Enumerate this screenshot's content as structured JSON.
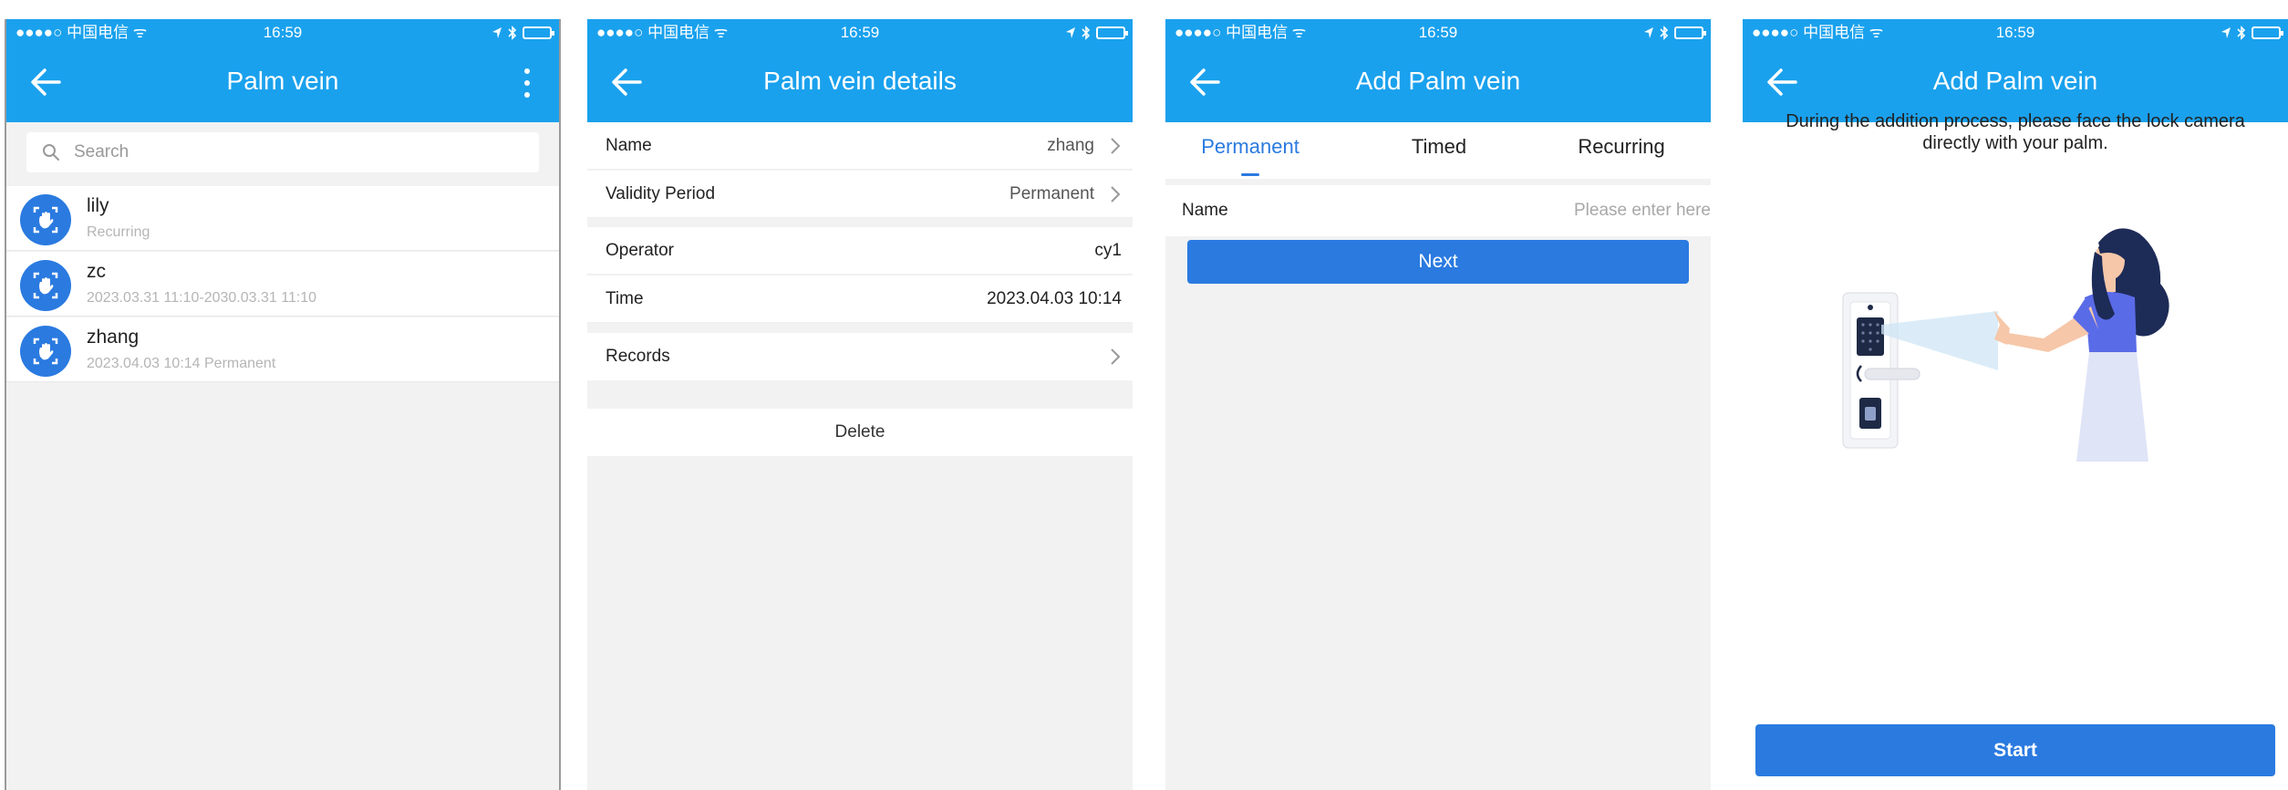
{
  "status_bar": {
    "carrier": "●●●●○ 中国电信 ᯤ",
    "time": "16:59"
  },
  "screen1": {
    "title": "Palm vein",
    "search_placeholder": "Search",
    "items": [
      {
        "name": "lily",
        "subtitle": "Recurring"
      },
      {
        "name": "zc",
        "subtitle": "2023.03.31 11:10-2030.03.31 11:10"
      },
      {
        "name": "zhang",
        "subtitle": "2023.04.03 10:14   Permanent"
      }
    ]
  },
  "screen2": {
    "title": "Palm vein details",
    "rows": [
      {
        "label": "Name",
        "value": "zhang"
      },
      {
        "label": "Validity Period",
        "value": "Permanent"
      },
      {
        "label": "Operator",
        "value": "cy1"
      },
      {
        "label": "Time",
        "value": "2023.04.03 10:14"
      },
      {
        "label": "Records",
        "value": ""
      }
    ],
    "delete_label": "Delete"
  },
  "screen3": {
    "title": "Add Palm vein",
    "tabs": [
      "Permanent",
      "Timed",
      "Recurring"
    ],
    "active_tab": "Permanent",
    "name_label": "Name",
    "name_placeholder": "Please enter here",
    "next_label": "Next"
  },
  "screen4": {
    "title": "Add Palm vein",
    "instruction": "During the addition process, please face the lock camera directly with your palm.",
    "start_label": "Start"
  },
  "colors": {
    "header_blue": "#1aa1ed",
    "button_blue": "#2a7ae0",
    "background_gray": "#f2f2f2"
  },
  "icons": [
    "back-arrow-icon",
    "more-vertical-icon",
    "search-icon",
    "palm-icon",
    "chevron-right-icon",
    "wifi-icon",
    "location-icon",
    "bluetooth-icon",
    "battery-icon"
  ]
}
